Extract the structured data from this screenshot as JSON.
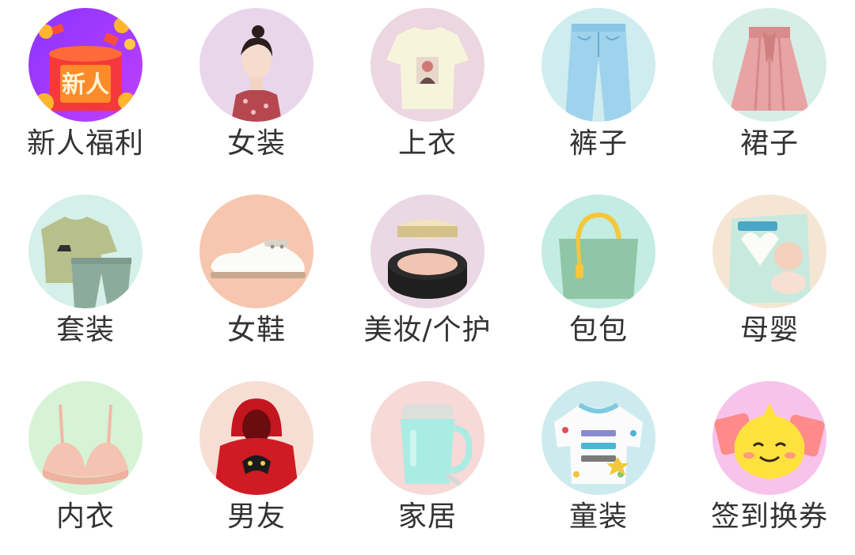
{
  "categories": [
    {
      "label": "新人福利",
      "badge": "新人",
      "icon": "red-envelope-icon"
    },
    {
      "label": "女装",
      "icon": "womens-clothing-icon"
    },
    {
      "label": "上衣",
      "icon": "top-shirt-icon"
    },
    {
      "label": "裤子",
      "icon": "jeans-icon"
    },
    {
      "label": "裙子",
      "icon": "skirt-icon"
    },
    {
      "label": "套装",
      "icon": "outfit-set-icon"
    },
    {
      "label": "女鞋",
      "icon": "womens-shoe-icon"
    },
    {
      "label": "美妆/个护",
      "icon": "cushion-compact-icon"
    },
    {
      "label": "包包",
      "icon": "handbag-icon"
    },
    {
      "label": "母婴",
      "icon": "diaper-pack-icon"
    },
    {
      "label": "内衣",
      "icon": "bra-icon"
    },
    {
      "label": "男友",
      "icon": "red-hoodie-icon"
    },
    {
      "label": "家居",
      "icon": "soymilk-maker-icon"
    },
    {
      "label": "童装",
      "icon": "kids-sweater-icon"
    },
    {
      "label": "签到换券",
      "icon": "smiley-coupon-icon"
    }
  ],
  "colors": {
    "label_text": "#333333",
    "background": "#ffffff"
  }
}
